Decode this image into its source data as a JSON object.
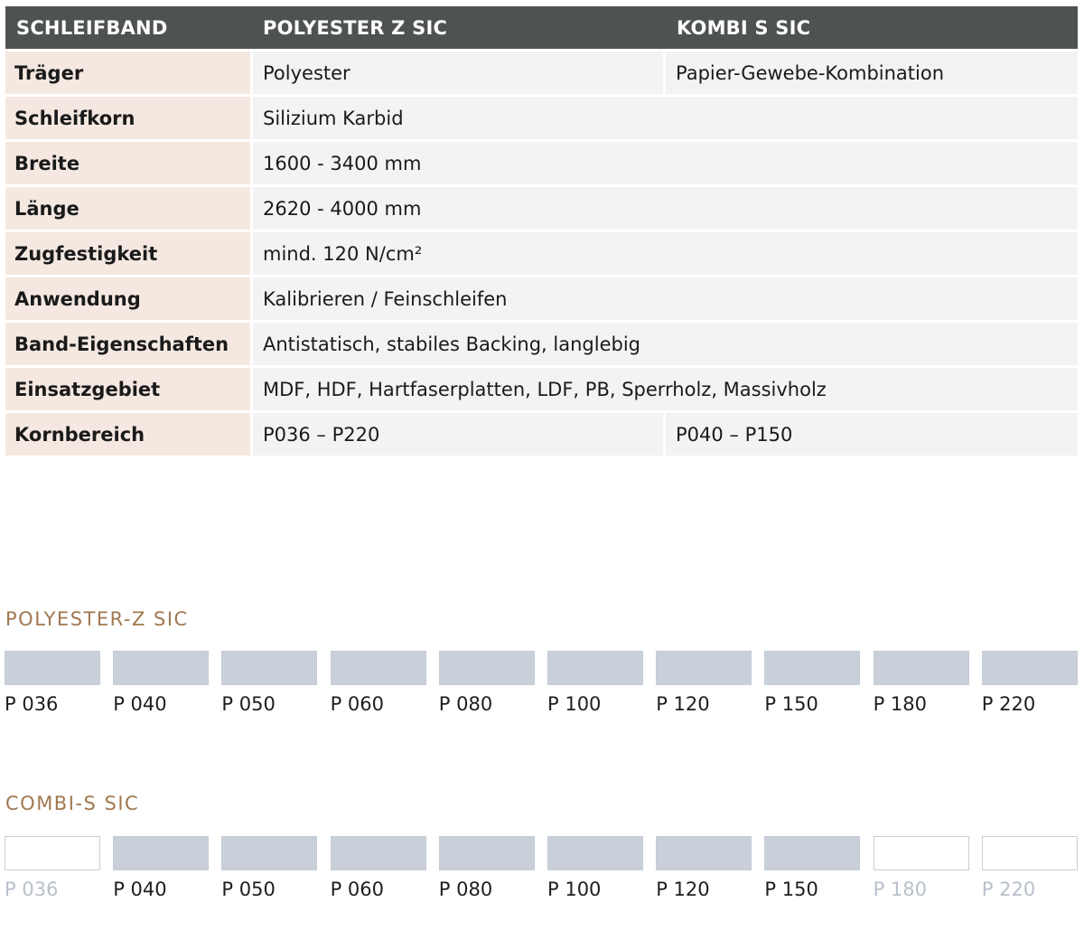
{
  "table": {
    "headers": [
      "SCHLEIFBAND",
      "POLYESTER Z SIC",
      "KOMBI S SIC"
    ],
    "rows": [
      {
        "label": "Träger",
        "v1": "Polyester",
        "v2": "Papier-Gewebe-Kombination"
      },
      {
        "label": "Schleifkorn",
        "v1": "Silizium Karbid"
      },
      {
        "label": "Breite",
        "v1": "1600 - 3400 mm"
      },
      {
        "label": "Länge",
        "v1": "2620 - 4000 mm"
      },
      {
        "label": "Zugfestigkeit",
        "v1": "mind. 120 N/cm²"
      },
      {
        "label": "Anwendung",
        "v1": "Kalibrieren / Feinschleifen"
      },
      {
        "label": "Band-Eigenschaften",
        "v1": "Antistatisch, stabiles Backing, langlebig"
      },
      {
        "label": "Einsatzgebiet",
        "v1": "MDF, HDF, Hartfaserplatten, LDF, PB, Sperrholz, Massivholz"
      },
      {
        "label": "Kornbereich",
        "v1": "P036 – P220",
        "v2": "P040 – P150"
      }
    ]
  },
  "polyester": {
    "title": "POLYESTER-Z SIC",
    "grits": [
      {
        "label": "P 036",
        "available": true
      },
      {
        "label": "P 040",
        "available": true
      },
      {
        "label": "P 050",
        "available": true
      },
      {
        "label": "P 060",
        "available": true
      },
      {
        "label": "P 080",
        "available": true
      },
      {
        "label": "P 100",
        "available": true
      },
      {
        "label": "P 120",
        "available": true
      },
      {
        "label": "P 150",
        "available": true
      },
      {
        "label": "P 180",
        "available": true
      },
      {
        "label": "P 220",
        "available": true
      }
    ]
  },
  "combi": {
    "title": "COMBI-S SIC",
    "grits": [
      {
        "label": "P 036",
        "available": false
      },
      {
        "label": "P 040",
        "available": true
      },
      {
        "label": "P 050",
        "available": true
      },
      {
        "label": "P 060",
        "available": true
      },
      {
        "label": "P 080",
        "available": true
      },
      {
        "label": "P 100",
        "available": true
      },
      {
        "label": "P 120",
        "available": true
      },
      {
        "label": "P 150",
        "available": true
      },
      {
        "label": "P 180",
        "available": false
      },
      {
        "label": "P 220",
        "available": false
      }
    ]
  },
  "colors": {
    "header_bg": "#4f5252",
    "label_bg": "#f4e8e1",
    "value_bg": "#f3f3f3",
    "section_title": "#a07850",
    "swatch_fill": "#c9d0da"
  }
}
